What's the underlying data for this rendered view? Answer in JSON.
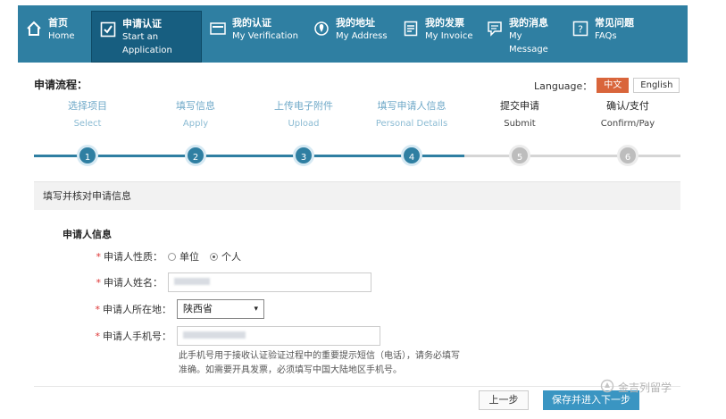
{
  "nav": [
    {
      "cn": "首页",
      "en": [
        "Home"
      ],
      "icon": "home-icon",
      "active": false,
      "w": 82
    },
    {
      "cn": "申请认证",
      "en": [
        "Start an",
        "Application"
      ],
      "icon": "check-icon",
      "active": true,
      "w": 124
    },
    {
      "cn": "我的认证",
      "en": [
        "My Verification"
      ],
      "icon": "verification-card-icon",
      "active": false,
      "w": 116
    },
    {
      "cn": "我的地址",
      "en": [
        "My Address"
      ],
      "icon": "location-pin-icon",
      "active": false,
      "w": 100
    },
    {
      "cn": "我的发票",
      "en": [
        "My Invoice"
      ],
      "icon": "invoice-icon",
      "active": false,
      "w": 94
    },
    {
      "cn": "我的消息",
      "en": [
        "My",
        "Message"
      ],
      "icon": "message-icon",
      "active": false,
      "w": 96
    },
    {
      "cn": "常见问题",
      "en": [
        "FAQs"
      ],
      "icon": "help-icon",
      "active": false,
      "w": 96
    }
  ],
  "flow_title": "申请流程：",
  "language": {
    "label": "Language：",
    "options": [
      "中文",
      "English"
    ],
    "selected": "中文"
  },
  "steps": [
    {
      "cn": "选择项目",
      "en": "Select",
      "num": "1",
      "done": true
    },
    {
      "cn": "填写信息",
      "en": "Apply",
      "num": "2",
      "done": true
    },
    {
      "cn": "上传电子附件",
      "en": "Upload",
      "num": "3",
      "done": true
    },
    {
      "cn": "填写申请人信息",
      "en": "Personal Details",
      "num": "4",
      "done": true
    },
    {
      "cn": "提交申请",
      "en": "Submit",
      "num": "5",
      "done": false
    },
    {
      "cn": "确认/支付",
      "en": "Confirm/Pay",
      "num": "6",
      "done": false
    }
  ],
  "section_title": "填写并核对申请信息",
  "applicant": {
    "title": "申请人信息",
    "type_label": "申请人性质：",
    "type_options": [
      "单位",
      "个人"
    ],
    "type_selected": "个人",
    "name_label": "申请人姓名：",
    "location_label": "申请人所在地：",
    "location_value": "陕西省",
    "phone_label": "申请人手机号：",
    "hint": "此手机号用于接收认证验证过程中的重要提示短信（电话），请务必填写准确。如需要开具发票，必须填写中国大陆地区手机号。"
  },
  "buttons": {
    "prev": "上一步",
    "next": "保存并进入下一步"
  },
  "watermark": "金吉列留学",
  "colors": {
    "nav_bg": "#2f7fa2",
    "nav_active": "#175e80",
    "accent": "#3a95c2",
    "lang_on": "#d9653b",
    "required": "#d33"
  }
}
